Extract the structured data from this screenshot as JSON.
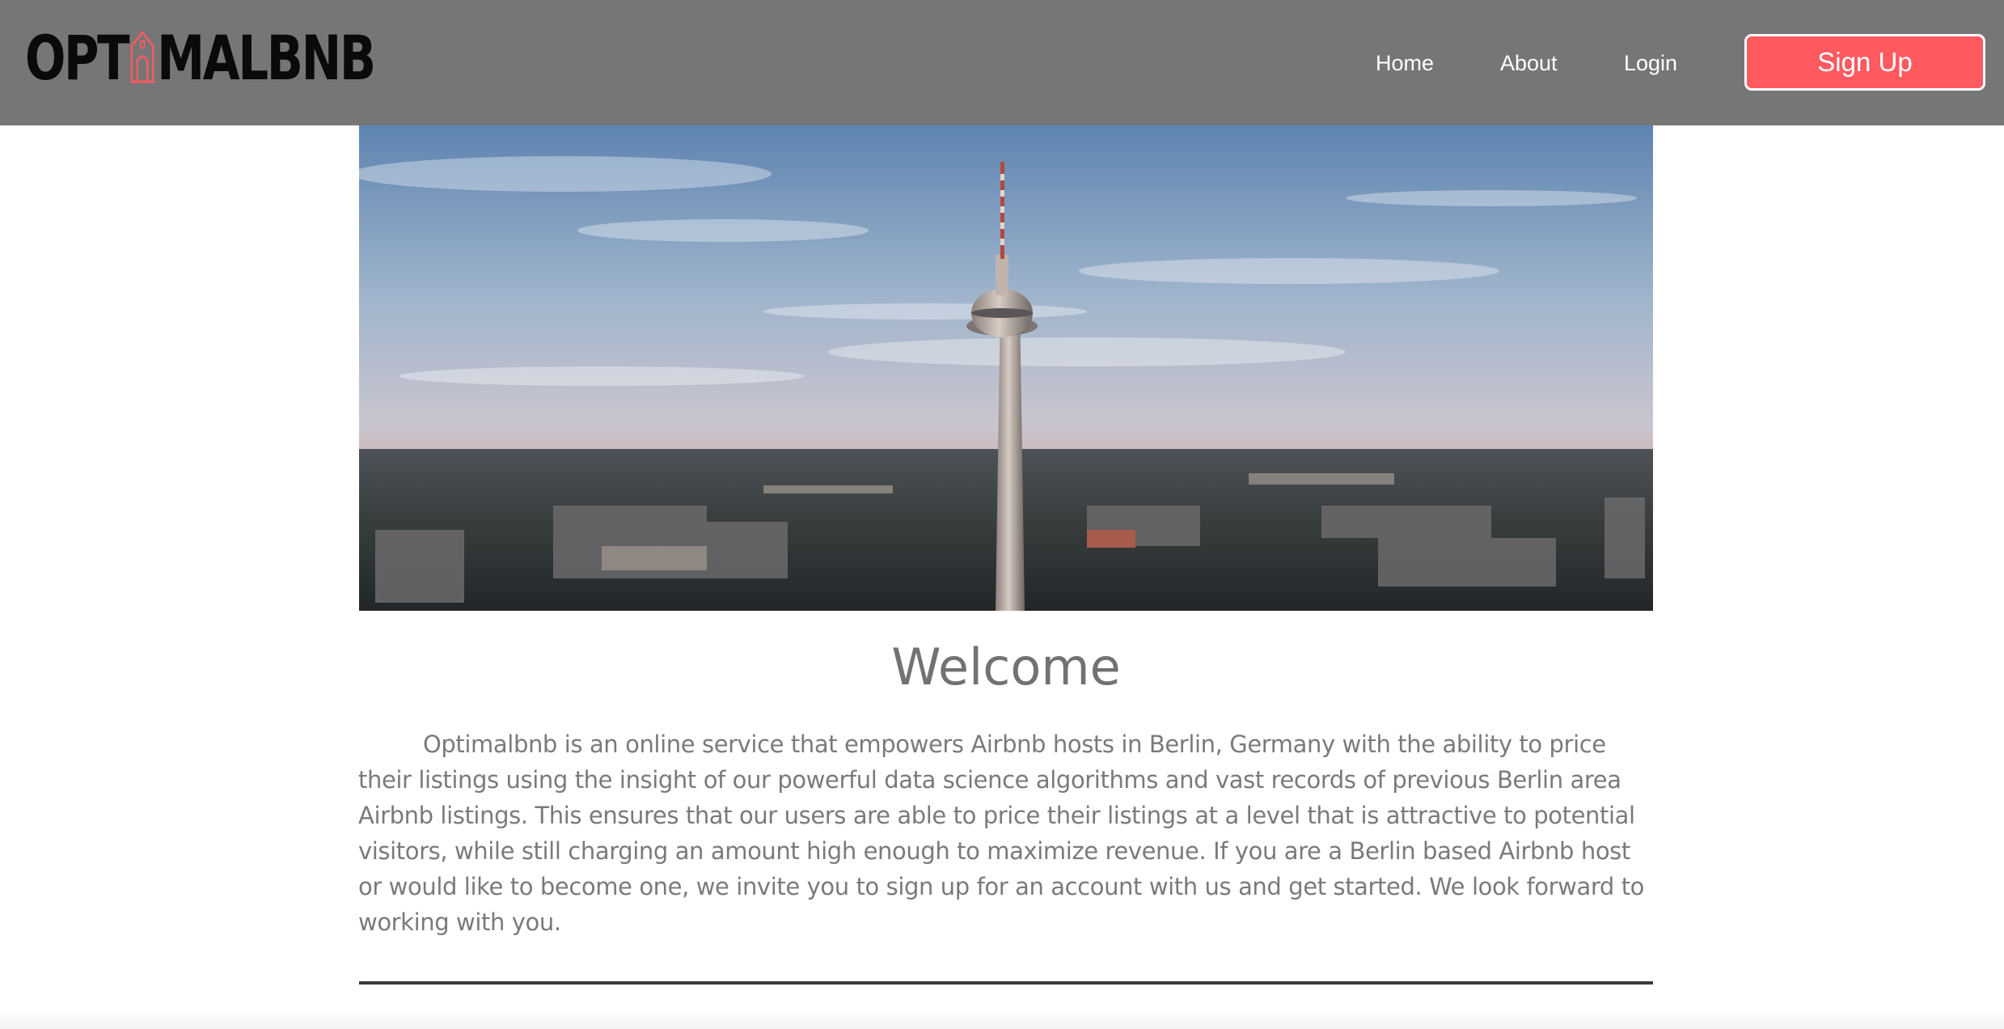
{
  "brand": {
    "logo_before": "OPT",
    "logo_after": "MALBNB",
    "logo_icon": "house-icon",
    "accent_color": "#ff5a5f",
    "nav_bg_color": "#767676"
  },
  "nav": {
    "home_label": "Home",
    "about_label": "About",
    "login_label": "Login",
    "signup_label": "Sign Up"
  },
  "hero": {
    "image_subject": "Berlin TV tower skyline photo"
  },
  "main": {
    "title": "Welcome",
    "body": "Optimalbnb is an online service that empowers Airbnb hosts in Berlin, Germany with the ability to price their listings using the insight of our powerful data science algorithms and vast records of previous Berlin area Airbnb listings. This ensures that our users are able to price their listings at a level that is attractive to potential visitors, while still charging an amount high enough to maximize revenue. If you are a Berlin based Airbnb host or would like to become one, we invite you to sign up for an account with us and get started. We look forward to working with you."
  }
}
